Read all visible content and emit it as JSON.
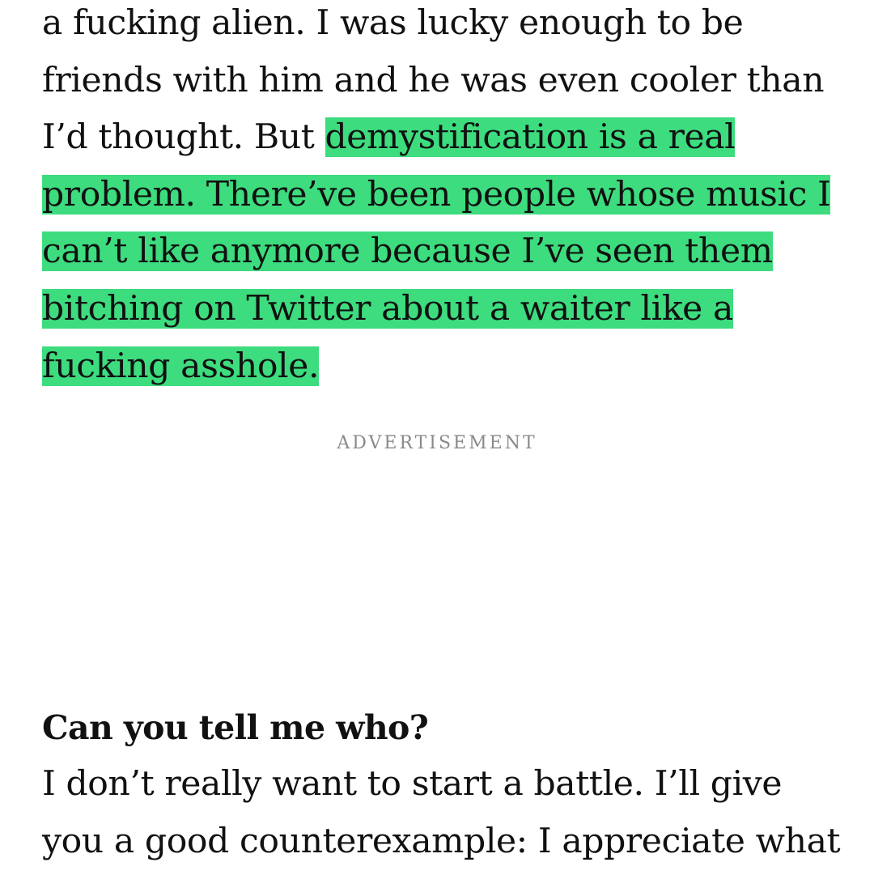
{
  "article": {
    "paragraph_1": {
      "plain": "a fucking alien. I was lucky enough to be friends with him and he was even cooler than I’d thought. But ",
      "highlighted": "demystification is a real problem. There’ve been people whose music I can’t like anymore because I’ve seen them bitching on Twitter about a waiter like a fucking asshole."
    },
    "ad_label": "ADVERTISEMENT",
    "question": "Can you tell me who?",
    "answer": "I don’t really want to start a battle. I’ll give you a good counterexample: I appreciate what"
  },
  "colors": {
    "highlight": "#3ddc7e",
    "text": "#111111",
    "ad_label": "#8a8a8a"
  }
}
